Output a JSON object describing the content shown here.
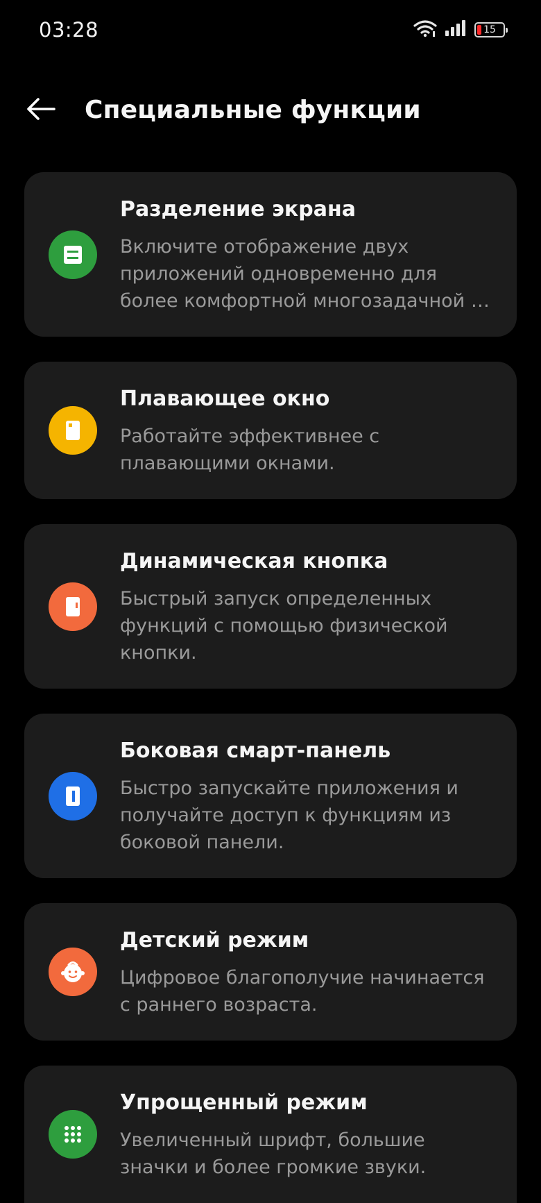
{
  "status_bar": {
    "time": "03:28",
    "battery_level": "15",
    "battery_color": "#ff2a2a"
  },
  "header": {
    "title": "Специальные функции"
  },
  "cards": [
    {
      "title": "Разделение экрана",
      "desc_lines": [
        "Включите отображение двух",
        "приложений одновременно для",
        "более комфортной многозадачной …"
      ],
      "icon": "split-screen-icon",
      "color": "#2e9e3e"
    },
    {
      "title": "Плавающее окно",
      "desc_lines": [
        "Работайте эффективнее с",
        "плавающими окнами."
      ],
      "icon": "floating-window-icon",
      "color": "#f5b400"
    },
    {
      "title": "Динамическая кнопка",
      "desc_lines": [
        "Быстрый запуск определенных",
        "функций с помощью физической",
        "кнопки."
      ],
      "icon": "dynamic-button-icon",
      "color": "#f26a3d"
    },
    {
      "title": "Боковая смарт-панель",
      "desc_lines": [
        "Быстро запускайте приложения и",
        "получайте доступ к функциям из",
        "боковой панели."
      ],
      "icon": "smart-sidebar-icon",
      "color": "#1f6fe6"
    },
    {
      "title": "Детский режим",
      "desc_lines": [
        "Цифровое благополучие начинается",
        "с раннего возраста."
      ],
      "icon": "kid-mode-icon",
      "color": "#f26a3d"
    },
    {
      "title": "Упрощенный режим",
      "desc_lines": [
        "Увеличенный шрифт, большие",
        "значки и более громкие звуки."
      ],
      "icon": "simple-mode-icon",
      "color": "#2e9e3e"
    }
  ]
}
